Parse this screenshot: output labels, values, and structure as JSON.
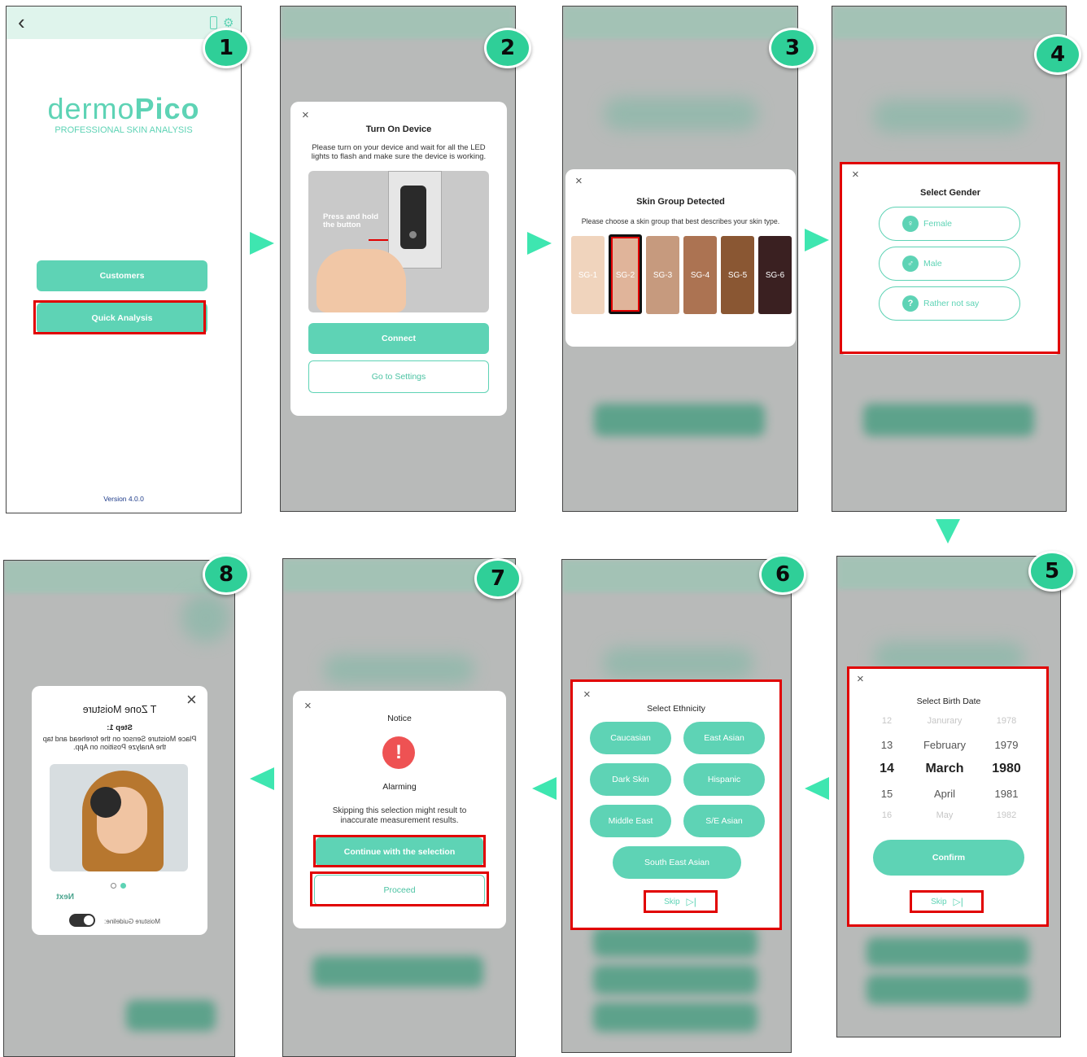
{
  "steps": [
    "1",
    "2",
    "3",
    "4",
    "5",
    "6",
    "7",
    "8"
  ],
  "screen1": {
    "logo_a": "dermo",
    "logo_b": "Pico",
    "tagline": "PROFESSIONAL SKIN ANALYSIS",
    "customers": "Customers",
    "quick": "Quick Analysis",
    "version": "Version 4.0.0",
    "back": "‹"
  },
  "screen2": {
    "title": "Turn On Device",
    "desc": "Please turn on your device and wait for all the LED lights to flash and make sure the device is working.",
    "img_caption": "Press and hold the button",
    "connect": "Connect",
    "settings": "Go to Settings"
  },
  "screen3": {
    "title": "Skin Group Detected",
    "desc": "Please choose a skin group that best describes your skin type.",
    "groups": [
      {
        "label": "SG-1",
        "color": "#f0d4bd"
      },
      {
        "label": "SG-2",
        "color": "#e0b49a"
      },
      {
        "label": "SG-3",
        "color": "#c69a7e"
      },
      {
        "label": "SG-4",
        "color": "#ac7352"
      },
      {
        "label": "SG-5",
        "color": "#8a5733"
      },
      {
        "label": "SG-6",
        "color": "#3a2021"
      }
    ]
  },
  "screen4": {
    "title": "Select Gender",
    "female": "Female",
    "male": "Male",
    "none": "Rather not say",
    "none_icon": "?"
  },
  "screen5": {
    "title": "Select Birth Date",
    "rows": [
      [
        "12",
        "Janurary",
        "1978"
      ],
      [
        "13",
        "February",
        "1979"
      ],
      [
        "14",
        "March",
        "1980"
      ],
      [
        "15",
        "April",
        "1981"
      ],
      [
        "16",
        "May",
        "1982"
      ]
    ],
    "confirm": "Confirm",
    "skip": "Skip"
  },
  "screen6": {
    "title": "Select Ethnicity",
    "options": [
      "Caucasian",
      "East Asian",
      "Dark Skin",
      "Hispanic",
      "Middle East",
      "S/E Asian",
      "South East Asian"
    ],
    "skip": "Skip"
  },
  "screen7": {
    "title": "Notice",
    "icon": "!",
    "heading": "Alarming",
    "desc": "Skipping this selection might result to inaccurate measurement results.",
    "continue": "Continue with the selection",
    "proceed": "Proceed"
  },
  "screen8": {
    "title": "T Zone Moisture",
    "step": "Step 1:",
    "desc": "Place Moisture Sensor on the forehead and tap the Analyze Position on App.",
    "next": "Next",
    "guide": "Moisture Guideline:"
  },
  "close": "×",
  "colors": {
    "accent": "#5ed3b5",
    "badge": "#2fcf98",
    "highlight": "#e10000",
    "arrow": "#3ee6b0"
  }
}
